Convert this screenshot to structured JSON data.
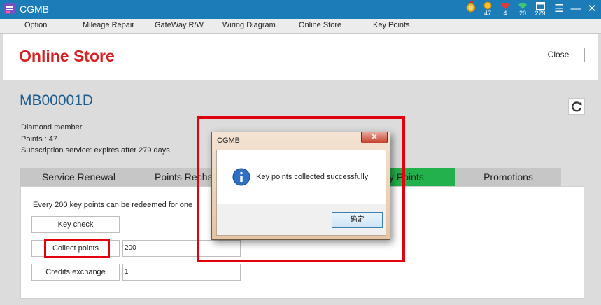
{
  "window": {
    "title": "CGMB",
    "stats": [
      {
        "icon": "medal-icon",
        "value": ""
      },
      {
        "icon": "coin-icon",
        "value": "47"
      },
      {
        "icon": "ruby-icon",
        "value": "4"
      },
      {
        "icon": "diamond-icon",
        "value": "20"
      },
      {
        "icon": "calendar-icon",
        "value": "279"
      }
    ]
  },
  "menu": {
    "items": [
      "Option",
      "Mileage Repair",
      "GateWay R/W",
      "Wiring Diagram",
      "Online Store",
      "Key Points"
    ]
  },
  "header": {
    "title": "Online Store",
    "close_label": "Close"
  },
  "member": {
    "id": "MB00001D",
    "level": "Diamond member",
    "points": "Points : 47",
    "subscription": "Subscription service: expires after 279 days"
  },
  "tabs": [
    "Service Renewal",
    "Points Recha",
    "y Points",
    "Promotions"
  ],
  "content": {
    "redeem_text": "Every 200 key points can be redeemed for one",
    "key_check_label": "Key check",
    "collect_label": "Collect points",
    "collect_value": "200",
    "credits_label": "Credits exchange",
    "credits_value": "1"
  },
  "dialog": {
    "title": "CGMB",
    "close_glyph": "✕",
    "message": "Key points collected successfully",
    "ok_label": "确定"
  },
  "colors": {
    "titlebar": "#1b7cb8",
    "title_red": "#d42020",
    "member_blue": "#1d5c8e",
    "active_tab": "#22b14c",
    "highlight_red": "#e2000d"
  }
}
